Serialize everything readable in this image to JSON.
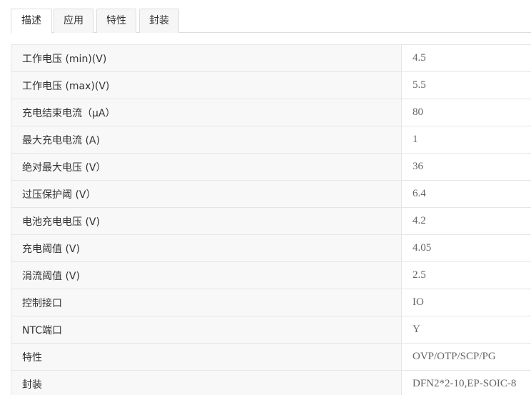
{
  "tabs": [
    {
      "label": "描述",
      "active": true
    },
    {
      "label": "应用",
      "active": false
    },
    {
      "label": "特性",
      "active": false
    },
    {
      "label": "封装",
      "active": false
    }
  ],
  "specs": [
    {
      "label": "工作电压 (min)(V)",
      "value": "4.5"
    },
    {
      "label": "工作电压 (max)(V)",
      "value": "5.5"
    },
    {
      "label": "充电结束电流（μA）",
      "value": "80"
    },
    {
      "label": "最大充电电流 (A)",
      "value": "1"
    },
    {
      "label": "绝对最大电压 (V）",
      "value": "36"
    },
    {
      "label": "过压保护阈 (V）",
      "value": "6.4"
    },
    {
      "label": "电池充电电压 (V)",
      "value": "4.2"
    },
    {
      "label": "充电阈值 (V)",
      "value": "4.05"
    },
    {
      "label": "涓流阈值 (V)",
      "value": "2.5"
    },
    {
      "label": "控制接口",
      "value": "IO"
    },
    {
      "label": "NTC端口",
      "value": "Y"
    },
    {
      "label": "特性",
      "value": "OVP/OTP/SCP/PG"
    },
    {
      "label": "封装",
      "value": "DFN2*2-10,EP-SOIC-8"
    }
  ]
}
